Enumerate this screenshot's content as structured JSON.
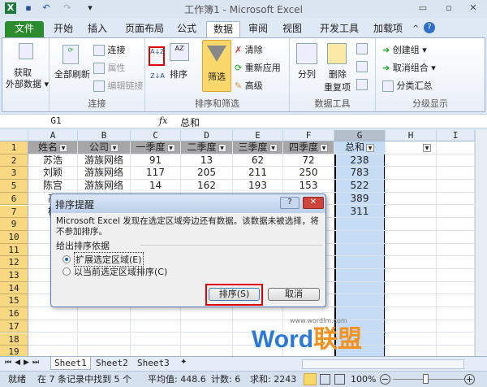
{
  "window": {
    "title": "工作簿1 - Microsoft Excel",
    "minimize": "▭",
    "restore": "▫",
    "close": "✕"
  },
  "quick_access": {
    "app": "X",
    "save": "▪",
    "undo": "↶",
    "redo": "↷",
    "customize": "▾"
  },
  "tabs": [
    {
      "label": "文件"
    },
    {
      "label": "开始"
    },
    {
      "label": "插入"
    },
    {
      "label": "页面布局"
    },
    {
      "label": "公式"
    },
    {
      "label": "数据"
    },
    {
      "label": "审阅"
    },
    {
      "label": "视图"
    },
    {
      "label": "开发工具"
    },
    {
      "label": "加载项"
    }
  ],
  "ribbon_right": {
    "caret": "^",
    "help": "?"
  },
  "ribbon": {
    "get_external": {
      "label1": "获取",
      "label2": "外部数据 ▾",
      "group": ""
    },
    "connections": {
      "refresh_all": "全部刷新",
      "connections": "连接",
      "properties": "属性",
      "edit_links": "编辑链接",
      "group": "连接"
    },
    "sort_filter": {
      "sort": "排序",
      "filter": "筛选",
      "clear": "清除",
      "reapply": "重新应用",
      "advanced": "高级",
      "group": "排序和筛选",
      "sort_az": "A↓Z",
      "sort_za": "Z↓A"
    },
    "data_tools": {
      "text_to_columns": "分列",
      "remove_dup1": "删除",
      "remove_dup2": "重复项",
      "group": "数据工具"
    },
    "outline": {
      "group_btn": "创建组 ▾",
      "ungroup": "取消组合 ▾",
      "subtotal": "分类汇总",
      "group": "分级显示"
    }
  },
  "formula_bar": {
    "name_box": "G1",
    "fx": "fx",
    "value": "总和"
  },
  "columns": [
    "A",
    "B",
    "C",
    "D",
    "E",
    "F",
    "G",
    "H",
    "I"
  ],
  "rows": [
    "1",
    "2",
    "3",
    "5",
    "6",
    "7",
    "9",
    "10",
    "11",
    "12",
    "13",
    "14",
    "15",
    "16",
    "17",
    "18",
    "19"
  ],
  "header_row": [
    "姓名",
    "公司",
    "一季度",
    "二季度",
    "三季度",
    "四季度",
    "总和"
  ],
  "data_rows": [
    [
      "苏浩",
      "游族网络",
      "91",
      "13",
      "62",
      "72",
      "238"
    ],
    [
      "刘颖",
      "游族网络",
      "117",
      "205",
      "211",
      "250",
      "783"
    ],
    [
      "陈宫",
      "游族网络",
      "14",
      "162",
      "193",
      "153",
      "522"
    ],
    [
      "高",
      "",
      "",
      "",
      "",
      "",
      "389"
    ],
    [
      "杨",
      "",
      "",
      "",
      "",
      "",
      "311"
    ]
  ],
  "dialog": {
    "title": "排序提醒",
    "help": "?",
    "close": "✕",
    "message": "Microsoft Excel 发现在选定区域旁边还有数据。该数据未被选择，将不参加排序。",
    "section": "给出排序依据",
    "option1": "扩展选定区域(E)",
    "option2": "以当前选定区域排序(C)",
    "selected": "option1",
    "sort_button": "排序(S)",
    "cancel_button": "取消"
  },
  "sheets": [
    "Sheet1",
    "Sheet2",
    "Sheet3"
  ],
  "status": {
    "ready": "就绪",
    "found": "在 7 条记录中找到 5 个",
    "average": "平均值: 448.6",
    "count": "计数: 6",
    "sum": "求和: 2243",
    "zoom": "100%"
  },
  "watermark": {
    "url": "www.wordlm.com",
    "word": "Word",
    "cn": "联盟"
  },
  "colors": {
    "file_tab": "#2c8a2f",
    "row_header": "#f8d880",
    "selection": "#c6dcf5",
    "highlight": "#e00000",
    "filter_active": "#fbd86b"
  }
}
